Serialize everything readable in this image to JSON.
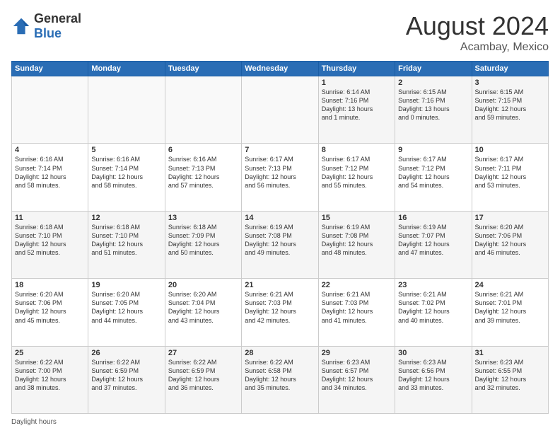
{
  "header": {
    "logo_general": "General",
    "logo_blue": "Blue",
    "month_year": "August 2024",
    "location": "Acambay, Mexico"
  },
  "footer": {
    "daylight_label": "Daylight hours"
  },
  "weekdays": [
    "Sunday",
    "Monday",
    "Tuesday",
    "Wednesday",
    "Thursday",
    "Friday",
    "Saturday"
  ],
  "weeks": [
    [
      {
        "day": "",
        "info": ""
      },
      {
        "day": "",
        "info": ""
      },
      {
        "day": "",
        "info": ""
      },
      {
        "day": "",
        "info": ""
      },
      {
        "day": "1",
        "info": "Sunrise: 6:14 AM\nSunset: 7:16 PM\nDaylight: 13 hours\nand 1 minute."
      },
      {
        "day": "2",
        "info": "Sunrise: 6:15 AM\nSunset: 7:16 PM\nDaylight: 13 hours\nand 0 minutes."
      },
      {
        "day": "3",
        "info": "Sunrise: 6:15 AM\nSunset: 7:15 PM\nDaylight: 12 hours\nand 59 minutes."
      }
    ],
    [
      {
        "day": "4",
        "info": "Sunrise: 6:16 AM\nSunset: 7:14 PM\nDaylight: 12 hours\nand 58 minutes."
      },
      {
        "day": "5",
        "info": "Sunrise: 6:16 AM\nSunset: 7:14 PM\nDaylight: 12 hours\nand 58 minutes."
      },
      {
        "day": "6",
        "info": "Sunrise: 6:16 AM\nSunset: 7:13 PM\nDaylight: 12 hours\nand 57 minutes."
      },
      {
        "day": "7",
        "info": "Sunrise: 6:17 AM\nSunset: 7:13 PM\nDaylight: 12 hours\nand 56 minutes."
      },
      {
        "day": "8",
        "info": "Sunrise: 6:17 AM\nSunset: 7:12 PM\nDaylight: 12 hours\nand 55 minutes."
      },
      {
        "day": "9",
        "info": "Sunrise: 6:17 AM\nSunset: 7:12 PM\nDaylight: 12 hours\nand 54 minutes."
      },
      {
        "day": "10",
        "info": "Sunrise: 6:17 AM\nSunset: 7:11 PM\nDaylight: 12 hours\nand 53 minutes."
      }
    ],
    [
      {
        "day": "11",
        "info": "Sunrise: 6:18 AM\nSunset: 7:10 PM\nDaylight: 12 hours\nand 52 minutes."
      },
      {
        "day": "12",
        "info": "Sunrise: 6:18 AM\nSunset: 7:10 PM\nDaylight: 12 hours\nand 51 minutes."
      },
      {
        "day": "13",
        "info": "Sunrise: 6:18 AM\nSunset: 7:09 PM\nDaylight: 12 hours\nand 50 minutes."
      },
      {
        "day": "14",
        "info": "Sunrise: 6:19 AM\nSunset: 7:08 PM\nDaylight: 12 hours\nand 49 minutes."
      },
      {
        "day": "15",
        "info": "Sunrise: 6:19 AM\nSunset: 7:08 PM\nDaylight: 12 hours\nand 48 minutes."
      },
      {
        "day": "16",
        "info": "Sunrise: 6:19 AM\nSunset: 7:07 PM\nDaylight: 12 hours\nand 47 minutes."
      },
      {
        "day": "17",
        "info": "Sunrise: 6:20 AM\nSunset: 7:06 PM\nDaylight: 12 hours\nand 46 minutes."
      }
    ],
    [
      {
        "day": "18",
        "info": "Sunrise: 6:20 AM\nSunset: 7:06 PM\nDaylight: 12 hours\nand 45 minutes."
      },
      {
        "day": "19",
        "info": "Sunrise: 6:20 AM\nSunset: 7:05 PM\nDaylight: 12 hours\nand 44 minutes."
      },
      {
        "day": "20",
        "info": "Sunrise: 6:20 AM\nSunset: 7:04 PM\nDaylight: 12 hours\nand 43 minutes."
      },
      {
        "day": "21",
        "info": "Sunrise: 6:21 AM\nSunset: 7:03 PM\nDaylight: 12 hours\nand 42 minutes."
      },
      {
        "day": "22",
        "info": "Sunrise: 6:21 AM\nSunset: 7:03 PM\nDaylight: 12 hours\nand 41 minutes."
      },
      {
        "day": "23",
        "info": "Sunrise: 6:21 AM\nSunset: 7:02 PM\nDaylight: 12 hours\nand 40 minutes."
      },
      {
        "day": "24",
        "info": "Sunrise: 6:21 AM\nSunset: 7:01 PM\nDaylight: 12 hours\nand 39 minutes."
      }
    ],
    [
      {
        "day": "25",
        "info": "Sunrise: 6:22 AM\nSunset: 7:00 PM\nDaylight: 12 hours\nand 38 minutes."
      },
      {
        "day": "26",
        "info": "Sunrise: 6:22 AM\nSunset: 6:59 PM\nDaylight: 12 hours\nand 37 minutes."
      },
      {
        "day": "27",
        "info": "Sunrise: 6:22 AM\nSunset: 6:59 PM\nDaylight: 12 hours\nand 36 minutes."
      },
      {
        "day": "28",
        "info": "Sunrise: 6:22 AM\nSunset: 6:58 PM\nDaylight: 12 hours\nand 35 minutes."
      },
      {
        "day": "29",
        "info": "Sunrise: 6:23 AM\nSunset: 6:57 PM\nDaylight: 12 hours\nand 34 minutes."
      },
      {
        "day": "30",
        "info": "Sunrise: 6:23 AM\nSunset: 6:56 PM\nDaylight: 12 hours\nand 33 minutes."
      },
      {
        "day": "31",
        "info": "Sunrise: 6:23 AM\nSunset: 6:55 PM\nDaylight: 12 hours\nand 32 minutes."
      }
    ]
  ]
}
